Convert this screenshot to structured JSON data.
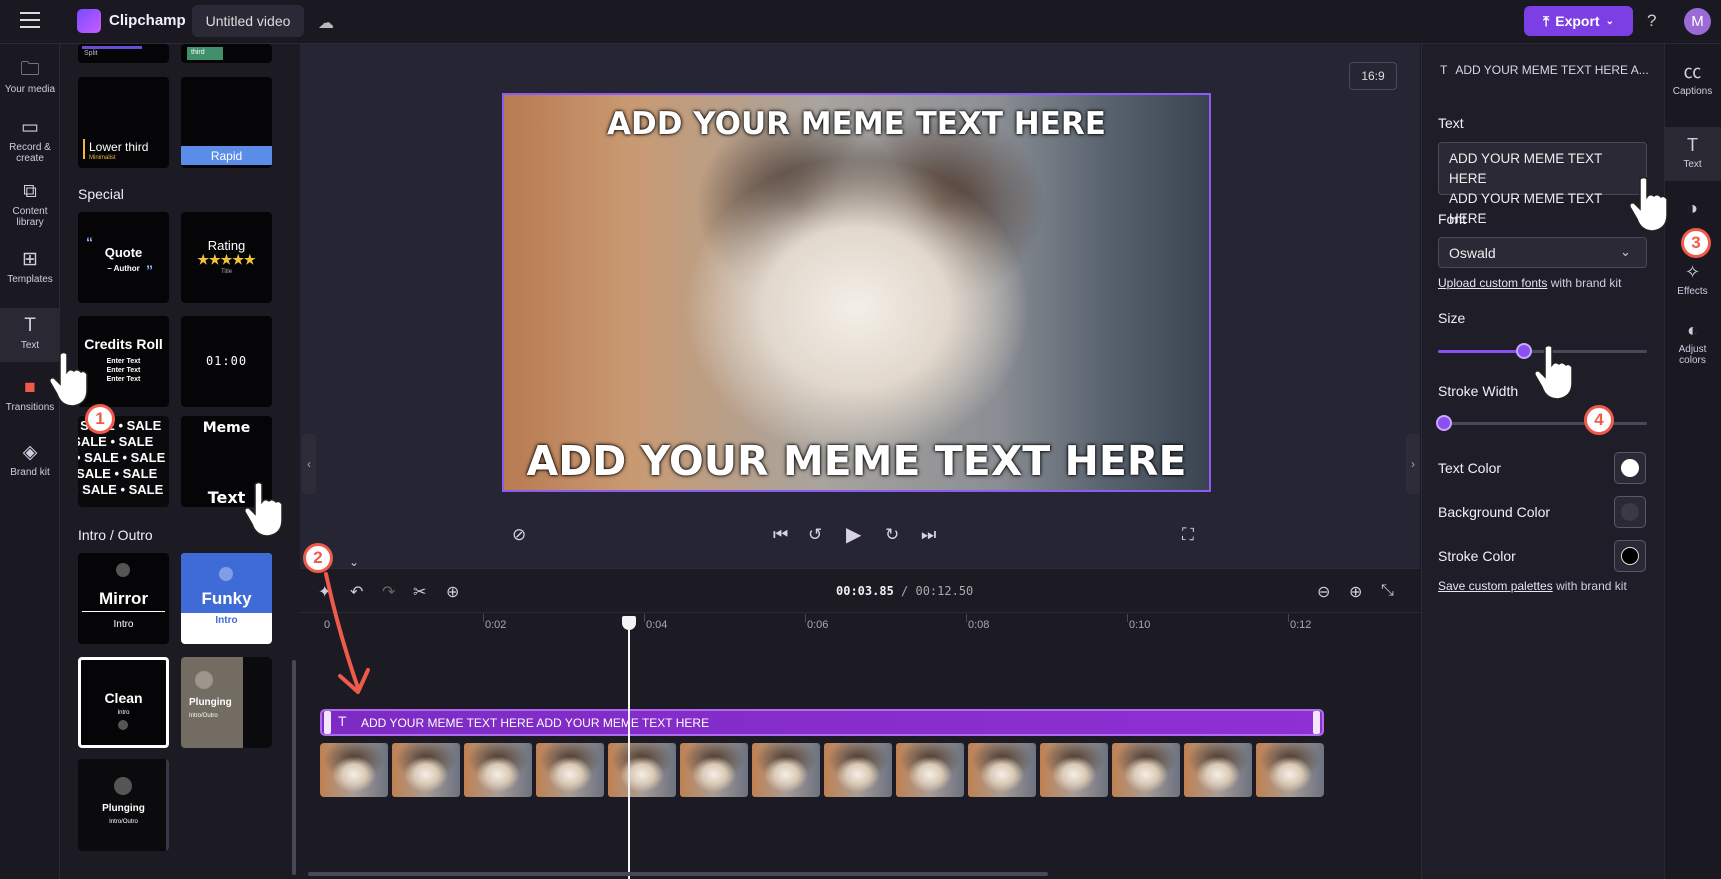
{
  "topbar": {
    "app_name": "Clipchamp",
    "project_name": "Untitled video",
    "export_label": "Export",
    "help_label": "?",
    "avatar_initial": "M"
  },
  "left_nav": {
    "items": [
      {
        "label": "Your media",
        "icon": "folder-icon"
      },
      {
        "label": "Record &\ncreate",
        "icon": "camera-icon"
      },
      {
        "label": "Content\nlibrary",
        "icon": "library-icon"
      },
      {
        "label": "Templates",
        "icon": "templates-icon"
      },
      {
        "label": "Text",
        "icon": "text-icon"
      },
      {
        "label": "Transitions",
        "icon": "transitions-icon"
      },
      {
        "label": "Brand kit",
        "icon": "brand-kit-icon"
      }
    ]
  },
  "panel": {
    "top_tiles": [
      {
        "caption": "Split"
      },
      {
        "caption": "third"
      }
    ],
    "lower_third": {
      "title": "Lower third",
      "subtitle": "Minimalist"
    },
    "rapid": {
      "title": "Rapid"
    },
    "section_special": "Special",
    "quote": {
      "title": "Quote",
      "author": "– Author"
    },
    "rating": {
      "title": "Rating",
      "stars": "★★★★★",
      "subtitle": "Title"
    },
    "credits": {
      "title": "Credits Roll",
      "lines": [
        "Enter Text",
        "Enter Text",
        "Enter Text"
      ]
    },
    "timer": {
      "value": "01:00"
    },
    "sale": {
      "text": "• SALE • SALE"
    },
    "meme": {
      "top": "Meme",
      "bottom": "Text"
    },
    "section_intro": "Intro / Outro",
    "mirror": {
      "title": "Mirror",
      "subtitle": "Intro"
    },
    "funky": {
      "title": "Funky",
      "subtitle": "Intro"
    },
    "clean": {
      "title": "Clean",
      "subtitle": "Intro"
    },
    "plunging1": {
      "title": "Plunging",
      "subtitle": "Intro/Outro"
    },
    "plunging2": {
      "title": "Plunging",
      "subtitle": "Intro/Outro"
    }
  },
  "stage": {
    "aspect_ratio": "16:9",
    "meme_top": "ADD YOUR MEME TEXT HERE",
    "meme_bottom": "ADD YOUR MEME TEXT HERE"
  },
  "timeline": {
    "current_time": "00:03.85",
    "total_time": "/ 00:12.50",
    "ticks": [
      "0",
      "0:02",
      "0:04",
      "0:06",
      "0:08",
      "0:10",
      "0:12"
    ],
    "text_clip_label": "ADD YOUR MEME TEXT HERE ADD YOUR MEME TEXT HERE",
    "thumb_count": 14
  },
  "props": {
    "panel_title": "ADD YOUR MEME TEXT HERE A...",
    "text_label": "Text",
    "text_line1": "ADD YOUR MEME TEXT HERE",
    "text_line2": "ADD YOUR MEME TEXT HERE",
    "font_label": "Font",
    "font_value": "Oswald",
    "upload_link": "Upload custom fonts",
    "upload_suffix": "with brand kit",
    "size_label": "Size",
    "size_value_fraction": 0.41,
    "stroke_label": "Stroke Width",
    "stroke_value_fraction": 0.0,
    "text_color_label": "Text Color",
    "text_color": "#ffffff",
    "bg_color_label": "Background Color",
    "bg_color": "#3a3946",
    "stroke_color_label": "Stroke Color",
    "stroke_color": "#000000",
    "palette_link": "Save custom palettes",
    "palette_suffix": "with brand kit"
  },
  "right_nav": {
    "items": [
      {
        "label": "Captions",
        "icon": "captions-icon"
      },
      {
        "label": "Text",
        "icon": "text-icon"
      },
      {
        "label": "Filters",
        "icon": "filters-icon"
      },
      {
        "label": "Effects",
        "icon": "effects-icon"
      },
      {
        "label": "Adjust\ncolors",
        "icon": "adjust-colors-icon"
      }
    ]
  },
  "annotations": {
    "steps": [
      "1",
      "2",
      "3",
      "4"
    ]
  },
  "colors": {
    "accent": "#7b3fe4",
    "clip": "#8f2fd4",
    "annotation": "#ef5a4a"
  }
}
